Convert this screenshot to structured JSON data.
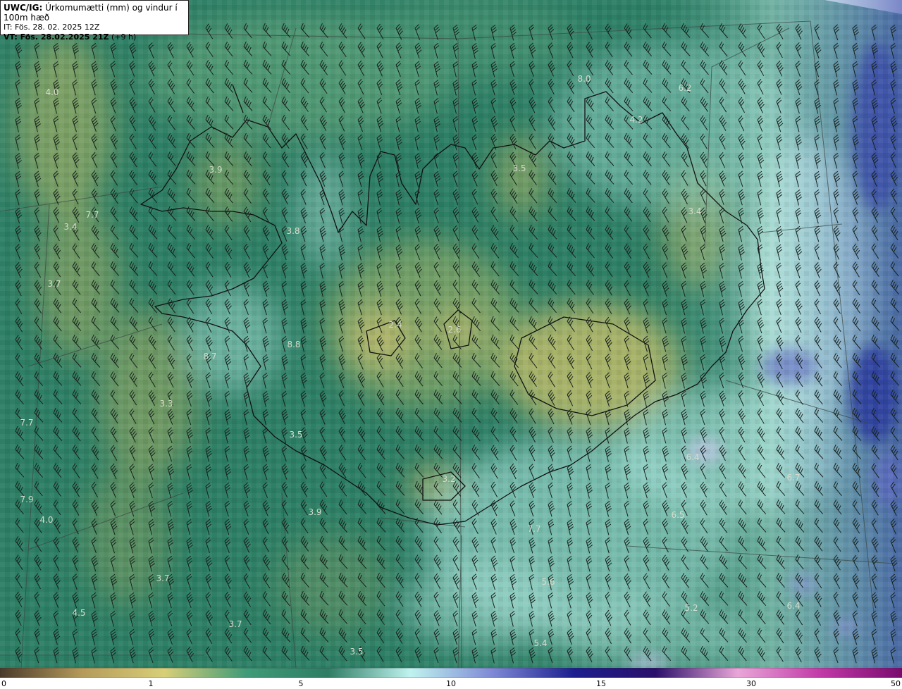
{
  "header": {
    "product": "UWC/IG:",
    "title": "Úrkomumætti (mm) og vindur í 100m hæð",
    "it_label": "IT: Fös. 28. 02. 2025 12Z",
    "vt_label": "VT: Fös. 28.02.2025 21Z",
    "lead": "(+9 h)"
  },
  "colorbar": {
    "ticks": [
      "0",
      "1",
      "5",
      "10",
      "15",
      "30",
      "50"
    ],
    "colors": [
      "#4a3a2a",
      "#b59a5a",
      "#d8cf78",
      "#3f9b78",
      "#2e7d64",
      "#bff3ef",
      "#7f8ad6",
      "#1c1f8f",
      "#2a0f6a",
      "#e9a6d8",
      "#c13aa8",
      "#7a0a6e"
    ]
  },
  "map": {
    "colors": {
      "base": "#2e7f66",
      "wet": "#4aa98e",
      "dry": "#a7b567",
      "cyan": "#c9f1ec",
      "blue": "#4b5fb3",
      "coast": "#111111",
      "grid": "#3c4a44",
      "barb": "#17211c"
    },
    "values": [
      "4.0",
      "8.0",
      "6.2",
      "4.2",
      "3.9",
      "3.5",
      "3.4",
      "7.7",
      "3.4",
      "3.8",
      "3.7",
      "2.4",
      "2.6",
      "8.8",
      "8.7",
      "3.3",
      "7.7",
      "3.5",
      "6.4",
      "6.7",
      "3.2",
      "7.9",
      "4.0",
      "3.9",
      "6.5",
      "7.7",
      "3.7",
      "5.6",
      "6.4",
      "5.2",
      "4.5",
      "3.7",
      "5.4",
      "3.5"
    ]
  }
}
